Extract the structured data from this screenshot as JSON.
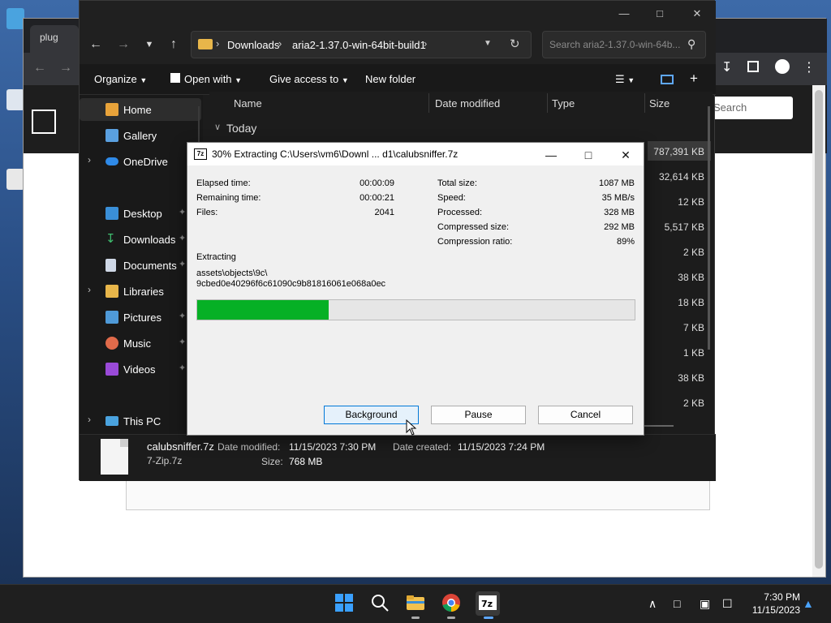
{
  "browser": {
    "tab_title": "plug",
    "search_placeholder": "Search"
  },
  "explorer": {
    "breadcrumb": [
      "Downloads",
      "aria2-1.37.0-win-64bit-build1"
    ],
    "search_placeholder": "Search aria2-1.37.0-win-64b...",
    "commands": {
      "organize": "Organize",
      "open_with": "Open with",
      "give_access": "Give access to",
      "new_folder": "New folder"
    },
    "nav": {
      "home": "Home",
      "gallery": "Gallery",
      "onedrive": "OneDrive",
      "desktop": "Desktop",
      "downloads": "Downloads",
      "documents": "Documents",
      "libraries": "Libraries",
      "pictures": "Pictures",
      "music": "Music",
      "videos": "Videos",
      "this_pc": "This PC"
    },
    "columns": {
      "name": "Name",
      "date_modified": "Date modified",
      "type": "Type",
      "size": "Size"
    },
    "group_label": "Today",
    "sizes": [
      "787,391 KB",
      "32,614 KB",
      "12 KB",
      "5,517 KB",
      "2 KB",
      "38 KB",
      "18 KB",
      "7 KB",
      "1 KB",
      "38 KB",
      "2 KB"
    ],
    "details": {
      "file_name": "calubsniffer.7z",
      "file_type": "7-Zip.7z",
      "date_modified_label": "Date modified:",
      "date_modified_value": "11/15/2023 7:30 PM",
      "date_created_label": "Date created:",
      "date_created_value": "11/15/2023 7:24 PM",
      "size_label": "Size:",
      "size_value": "768 MB"
    }
  },
  "dialog": {
    "title": "30% Extracting C:\\Users\\vm6\\Downl ... d1\\calubsniffer.7z",
    "app_icon_label": "7z",
    "elapsed_label": "Elapsed time:",
    "elapsed_value": "00:00:09",
    "remaining_label": "Remaining time:",
    "remaining_value": "00:00:21",
    "files_label": "Files:",
    "files_value": "2041",
    "total_size_label": "Total size:",
    "total_size_value": "1087 MB",
    "speed_label": "Speed:",
    "speed_value": "35 MB/s",
    "processed_label": "Processed:",
    "processed_value": "328 MB",
    "compressed_label": "Compressed size:",
    "compressed_value": "292 MB",
    "ratio_label": "Compression ratio:",
    "ratio_value": "89%",
    "extracting_label": "Extracting",
    "current_path_line1": "assets\\objects\\9c\\",
    "current_path_line2": "9cbed0e40296f6c61090c9b81816061e068a0ec",
    "progress_fraction": 0.3,
    "buttons": {
      "background": "Background",
      "pause": "Pause",
      "cancel": "Cancel"
    }
  },
  "taskbar": {
    "time": "7:30 PM",
    "date": "11/15/2023"
  },
  "colors": {
    "progress_green": "#06b025",
    "accent_blue": "#0078d7",
    "explorer_bg": "#1c1c1c"
  }
}
